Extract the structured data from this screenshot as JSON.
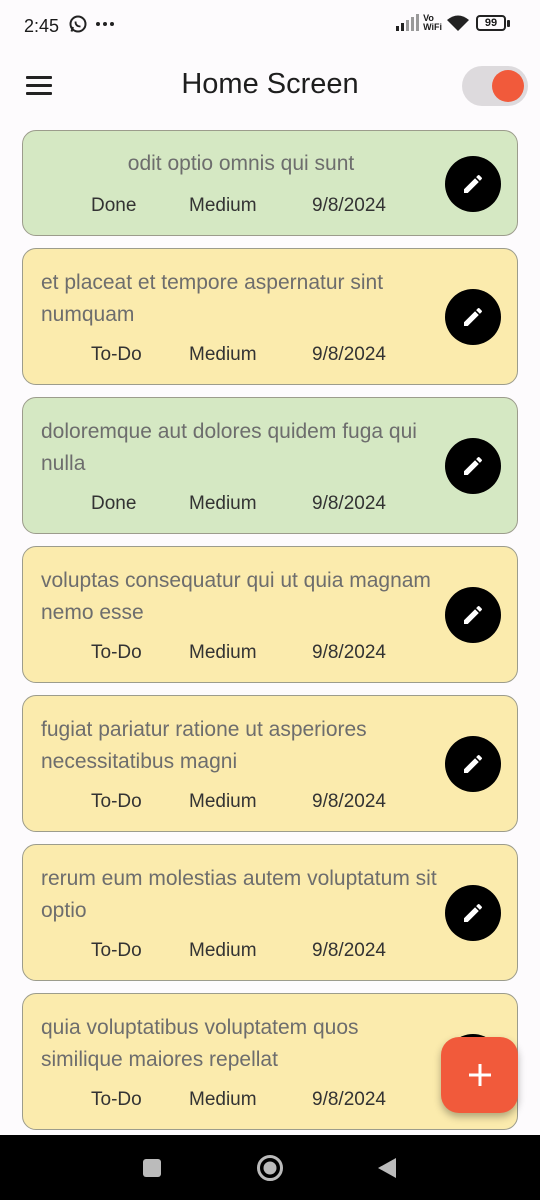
{
  "status_bar": {
    "time": "2:45",
    "left_icons": [
      "whatsapp-icon",
      "more-dots-icon"
    ],
    "right_icons": [
      "signal-icon",
      "vowifi-icon",
      "wifi-icon",
      "battery-icon"
    ],
    "vowifi_top": "Vo",
    "vowifi_bottom": "WiFi",
    "battery_level": "99"
  },
  "app_bar": {
    "title": "Home Screen",
    "menu_icon": "hamburger-menu-icon",
    "toggle_on": true,
    "accent_color": "#f15a3b"
  },
  "colors": {
    "done_card": "#d5e8c3",
    "todo_card": "#fbebad",
    "edit_button": "#000000",
    "fab": "#f15a3b"
  },
  "tasks": [
    {
      "title": "odit optio omnis qui sunt",
      "status": "Done",
      "priority": "Medium",
      "date": "9/8/2024"
    },
    {
      "title": "et placeat et tempore aspernatur sint numquam",
      "status": "To-Do",
      "priority": "Medium",
      "date": "9/8/2024"
    },
    {
      "title": "doloremque aut dolores quidem fuga qui nulla",
      "status": "Done",
      "priority": "Medium",
      "date": "9/8/2024"
    },
    {
      "title": "voluptas consequatur qui ut quia magnam nemo esse",
      "status": "To-Do",
      "priority": "Medium",
      "date": "9/8/2024"
    },
    {
      "title": "fugiat pariatur ratione ut asperiores necessitatibus magni",
      "status": "To-Do",
      "priority": "Medium",
      "date": "9/8/2024"
    },
    {
      "title": "rerum eum molestias autem voluptatum sit optio",
      "status": "To-Do",
      "priority": "Medium",
      "date": "9/8/2024"
    },
    {
      "title": "quia voluptatibus voluptatem quos similique maiores repellat",
      "status": "To-Do",
      "priority": "Medium",
      "date": "9/8/2024"
    }
  ],
  "fab": {
    "icon": "plus-icon",
    "label": "+"
  },
  "nav_bar": {
    "buttons": [
      "recents-square-icon",
      "home-circle-icon",
      "back-triangle-icon"
    ]
  }
}
